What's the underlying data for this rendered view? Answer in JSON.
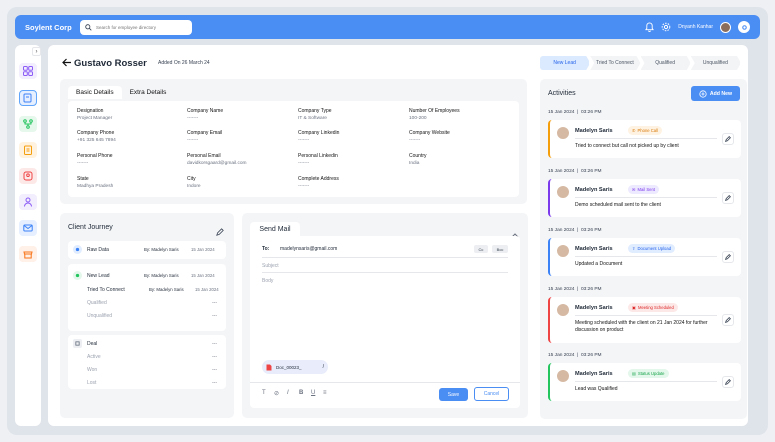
{
  "brand": "Soylent Corp",
  "search": {
    "placeholder": "Search for employee directory"
  },
  "user": {
    "name": "Dnyanh Kanhar"
  },
  "lead": {
    "name": "Gustavo Rosser",
    "added": "Added On 26 March 24"
  },
  "stages": [
    "New Lead",
    "Tried To Connect",
    "Qualified",
    "Unqualified"
  ],
  "details": {
    "tabs": [
      "Basic Details",
      "Extra Details"
    ],
    "fields": [
      {
        "label": "Designation",
        "value": "Project Manager"
      },
      {
        "label": "Company Name",
        "value": "-------"
      },
      {
        "label": "Company Type",
        "value": "IT & Software"
      },
      {
        "label": "Number Of Employees",
        "value": "100-200"
      },
      {
        "label": "Company Phone",
        "value": "+91 325 645 7894"
      },
      {
        "label": "Company Email",
        "value": "-------"
      },
      {
        "label": "Company Linkedin",
        "value": "-------"
      },
      {
        "label": "Company Website",
        "value": "-------"
      },
      {
        "label": "Personal Phone",
        "value": "-------"
      },
      {
        "label": "Personal Email",
        "value": "davidkorsgaard@gmail.com"
      },
      {
        "label": "Personal Linkedin",
        "value": "-------"
      },
      {
        "label": "Country",
        "value": "India"
      },
      {
        "label": "State",
        "value": "Madhya Pradesh"
      },
      {
        "label": "City",
        "value": "Indore"
      },
      {
        "label": "Complete Address",
        "value": "-------"
      }
    ]
  },
  "journey": {
    "title": "Client Journey",
    "raw": {
      "label": "Raw Data",
      "by": "By: Madelyn Saris",
      "date": "15 Jan 2024"
    },
    "new_lead": {
      "label": "New Lead",
      "by": "By: Madelyn Saris",
      "date": "15 Jan 2024"
    },
    "tried": {
      "label": "Tried To Connect",
      "by": "By: Madelyn Saris",
      "date": "15 Jan 2024"
    },
    "qualified": {
      "label": "Qualified",
      "dash": "---"
    },
    "unqualified": {
      "label": "Unqualified",
      "dash": "---"
    },
    "deal": {
      "label": "Deal",
      "dash": "---"
    },
    "active": {
      "label": "Active",
      "dash": "---"
    },
    "won": {
      "label": "Won",
      "dash": "---"
    },
    "lost": {
      "label": "Lost",
      "dash": "---"
    }
  },
  "mail": {
    "tab": "Send Mail",
    "to_label": "To:",
    "to": "madelynsaris@gmail.com",
    "cc": "Cc",
    "bcc": "Bcc",
    "subject": "Subject",
    "body": "Body",
    "attachment": "Doc_00023_",
    "save": "Save",
    "cancel": "Cancel"
  },
  "activities": {
    "title": "Activities",
    "add": "Add New",
    "items": [
      {
        "date": "15 Jan 2024",
        "time": "03:26 PM",
        "name": "Madelyn Saris",
        "badge": "Phone Call",
        "text": "Tried to connect but call not picked up by client",
        "color": "#f59e0b",
        "badge_bg": "#fef3e2",
        "badge_fg": "#d97706"
      },
      {
        "date": "15 Jan 2024",
        "time": "03:26 PM",
        "name": "Madelyn Saris",
        "badge": "Mail Sent",
        "text": "Demo scheduled mail sent to the client",
        "color": "#7c3aed",
        "badge_bg": "#ede9fe",
        "badge_fg": "#7c3aed"
      },
      {
        "date": "15 Jan 2024",
        "time": "03:26 PM",
        "name": "Madelyn Saris",
        "badge": "Document Upload",
        "text": "Updated a Document",
        "color": "#3b82f6",
        "badge_bg": "#e0ecff",
        "badge_fg": "#2563eb"
      },
      {
        "date": "15 Jan 2024",
        "time": "03:26 PM",
        "name": "Madelyn Saris",
        "badge": "Meeting Scheduled",
        "text": "Meeting scheduled with the client on 21 Jan 2024 for further discussion on product",
        "color": "#ef4444",
        "badge_bg": "#fde8e8",
        "badge_fg": "#dc2626"
      },
      {
        "date": "15 Jan 2024",
        "time": "03:26 PM",
        "name": "Madelyn Saris",
        "badge": "Status Update",
        "text": "Lead was Qualified",
        "color": "#22c55e",
        "badge_bg": "#e3f7ea",
        "badge_fg": "#16a34a"
      }
    ]
  }
}
